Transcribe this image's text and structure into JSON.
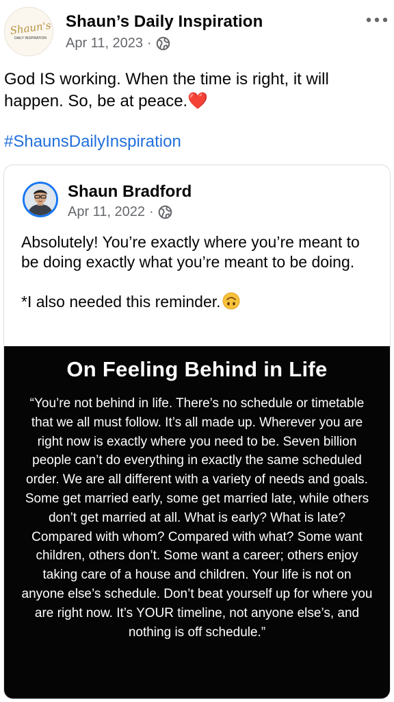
{
  "header": {
    "page_name": "Shaun’s Daily Inspiration",
    "date": "Apr 11, 2023",
    "separator": "·",
    "avatar_logo_text": "Shaun's",
    "avatar_logo_subtext": "DAILY INSPIRATION",
    "privacy_icon": "globe-icon",
    "menu_icon": "more-horizontal-icon"
  },
  "post": {
    "text": "God IS working. When the time is right, it will happen. So, be at peace.",
    "emoji": "❤️",
    "hashtag": "#ShaunsDailyInspiration"
  },
  "shared_post": {
    "author_name": "Shaun Bradford",
    "date": "Apr 11, 2022",
    "separator": "·",
    "privacy_icon": "globe-icon",
    "text_line1": "Absolutely! You’re exactly where you’re meant to be doing exactly what you’re meant to be doing.",
    "text_line2": "*I also needed this reminder.",
    "emoji": "upside-down-face-emoji",
    "image": {
      "title": "On Feeling Behind in Life",
      "quote": "“You’re not behind in life. There’s no schedule or timetable that we all must follow. It’s all made up. Wherever you are right now is exactly where you need to be. Seven billion people can’t do everything in exactly the same scheduled order. We are all different with a variety of needs and goals. Some get married early, some get married late, while others don’t get married at all. What is early? What is late? Compared with whom? Compared with what? Some want children, others don’t. Some want a career; others enjoy taking care of a house and children. Your life is not on anyone else’s schedule. Don’t beat yourself up for where you are right now. It’s YOUR timeline, not anyone else’s, and nothing is off schedule.”",
      "background_color": "#050505"
    }
  },
  "colors": {
    "link": "#216fdb",
    "meta_text": "#65676b",
    "avatar_ring": "#1877f2"
  }
}
